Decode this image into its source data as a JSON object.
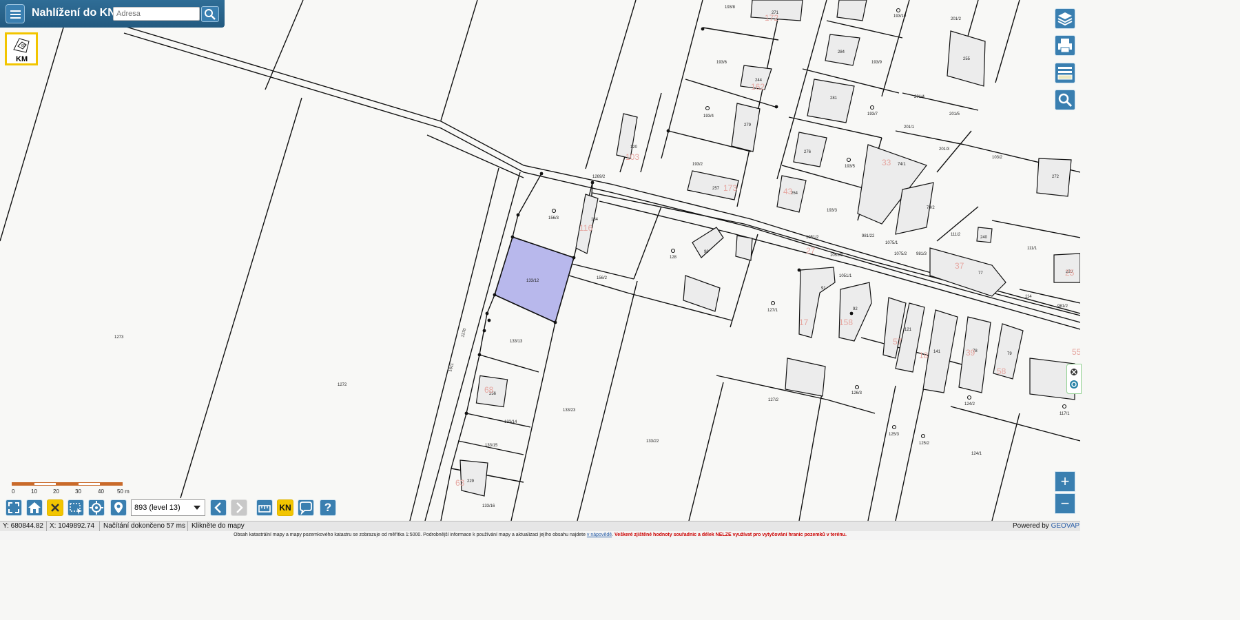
{
  "app": {
    "title": "Nahlížení do KN",
    "search_placeholder": "Adresa"
  },
  "km_badge": {
    "label": "KM",
    "icon_number": "60"
  },
  "scale": {
    "ticks": [
      "0",
      "10",
      "20",
      "30",
      "40",
      "50 m"
    ],
    "select_value": "893 (level 13)"
  },
  "toolbar": {
    "kn_label": "KN",
    "help_label": "?"
  },
  "zoom": {
    "in": "+",
    "out": "−"
  },
  "status": {
    "y": "Y: 680844.82",
    "x": "X: 1049892.74",
    "load": "Načítání dokončeno 57 ms",
    "hint": "Klikněte do mapy",
    "powered_prefix": "Powered by ",
    "powered_brand": "GEOVAP"
  },
  "notice": {
    "text": "Obsah katastrální mapy a mapy pozemkového katastru se zobrazuje od měřítka 1:5000. Podrobnější informace k používání mapy a aktualizaci jejího obsahu najdete ",
    "link": "v nápovědě",
    "warning": "Veškeré zjištěné hodnoty souřadnic a délek NELZE využívat pro vytyčování hranic pozemků v terénu."
  },
  "colors": {
    "header": "#2f6d96",
    "button": "#3a7fb0",
    "accent_yellow": "#f2c500",
    "selected_parcel": "#b8b8ec"
  },
  "map": {
    "parcels": [
      "1273",
      "1272",
      "1270",
      "1611",
      "133/12",
      "133/13",
      "133/14",
      "133/15",
      "133/16",
      "133/22",
      "133/23",
      "156/3",
      "156/2",
      "134",
      "1269/2",
      "120",
      "128",
      "90",
      "127/1",
      "127/2",
      "126/3",
      "125/3",
      "125/2",
      "124/1",
      "124/2",
      "117/1",
      "114",
      "111/1",
      "111/2",
      "240",
      "220",
      "981/2",
      "981/22",
      "1075/2",
      "1051/2",
      "1051/3",
      "1051/1",
      "981/3",
      "1075/1",
      "74/1",
      "74/2",
      "77",
      "193/8",
      "271",
      "193/10",
      "201/2",
      "284",
      "255",
      "193/9",
      "193/6",
      "244",
      "193/4",
      "279",
      "281",
      "193/7",
      "201/4",
      "201/5",
      "201/1",
      "201/3",
      "103/2",
      "272",
      "276",
      "193/5",
      "193/2",
      "257",
      "254",
      "193/3",
      "91",
      "92",
      "121",
      "141",
      "78",
      "79",
      "256",
      "229"
    ],
    "building_numbers": [
      "172",
      "162",
      "103",
      "173",
      "116",
      "158",
      "68",
      "63",
      "37",
      "27",
      "33",
      "17",
      "58",
      "57",
      "43",
      "39",
      "18",
      "25",
      "55"
    ]
  }
}
